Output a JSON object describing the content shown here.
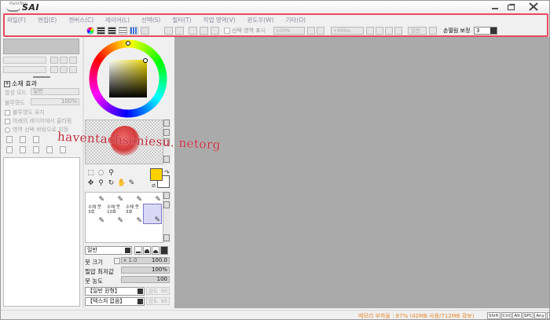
{
  "app": {
    "logo_small": "PaintTool",
    "logo_big": "SAI"
  },
  "menu": [
    {
      "id": "file",
      "label": "파일(F)"
    },
    {
      "id": "edit",
      "label": "편집(E)"
    },
    {
      "id": "canvas",
      "label": "캔버스(C)"
    },
    {
      "id": "layer",
      "label": "레이어(L)"
    },
    {
      "id": "select",
      "label": "선택(S)"
    },
    {
      "id": "filter",
      "label": "필터(T)"
    },
    {
      "id": "view",
      "label": "작업 영역(V)"
    },
    {
      "id": "window",
      "label": "윈도우(W)"
    },
    {
      "id": "other",
      "label": "기타(O)"
    }
  ],
  "toolbar": {
    "show_selection": "선택 영역 표시",
    "zoom": "100%",
    "rotation": "+000o",
    "normal": "일반",
    "stabilizer_label": "손떨림 보정",
    "stabilizer_value": "3"
  },
  "layer_panel": {
    "section_title": "소재 효과",
    "blend_mode_label": "합성 모드",
    "blend_mode_value": "일반",
    "opacity_label": "불투명도",
    "opacity_value": "100%",
    "protect_opacity": "불투명도 유지",
    "clip_to_lower": "아래의 레이어에서 클리핑",
    "select_source": "영역 선택 바탕으로 지정"
  },
  "watermark": "haventachsoniesu. netorg",
  "brushes": [
    {
      "name": "수채 붓\n3호"
    },
    {
      "name": "수채 붓\n10호"
    },
    {
      "name": "수채 붓\n3호"
    },
    {
      "name": ""
    }
  ],
  "tool_options": {
    "mode": "일반",
    "brush_size_label": "붓 크기",
    "brush_size_mult": "x 1.0",
    "brush_size_value": "100.0",
    "min_size_label": "필압 최저값",
    "min_size_value": "100%",
    "density_label": "붓 농도",
    "density_value": "100",
    "shape_select": "【일반 원형】",
    "shape_strength_label": "강도",
    "shape_strength_value": "50",
    "texture_select": "【텍스처 없음】",
    "texture_strength_label": "강도",
    "texture_strength_value": "95"
  },
  "status": {
    "memory": "메모리 부하율 : 87% (42MB 사용/712MB 확보)",
    "keys": [
      "Shift",
      "Ctrl",
      "Alt",
      "SPC",
      "Any"
    ]
  },
  "colors": {
    "highlight": "#e84a5f",
    "foreground": "#ffd200",
    "canvas_bg": "#aaaaaa",
    "status_text": "#e58a2c"
  }
}
